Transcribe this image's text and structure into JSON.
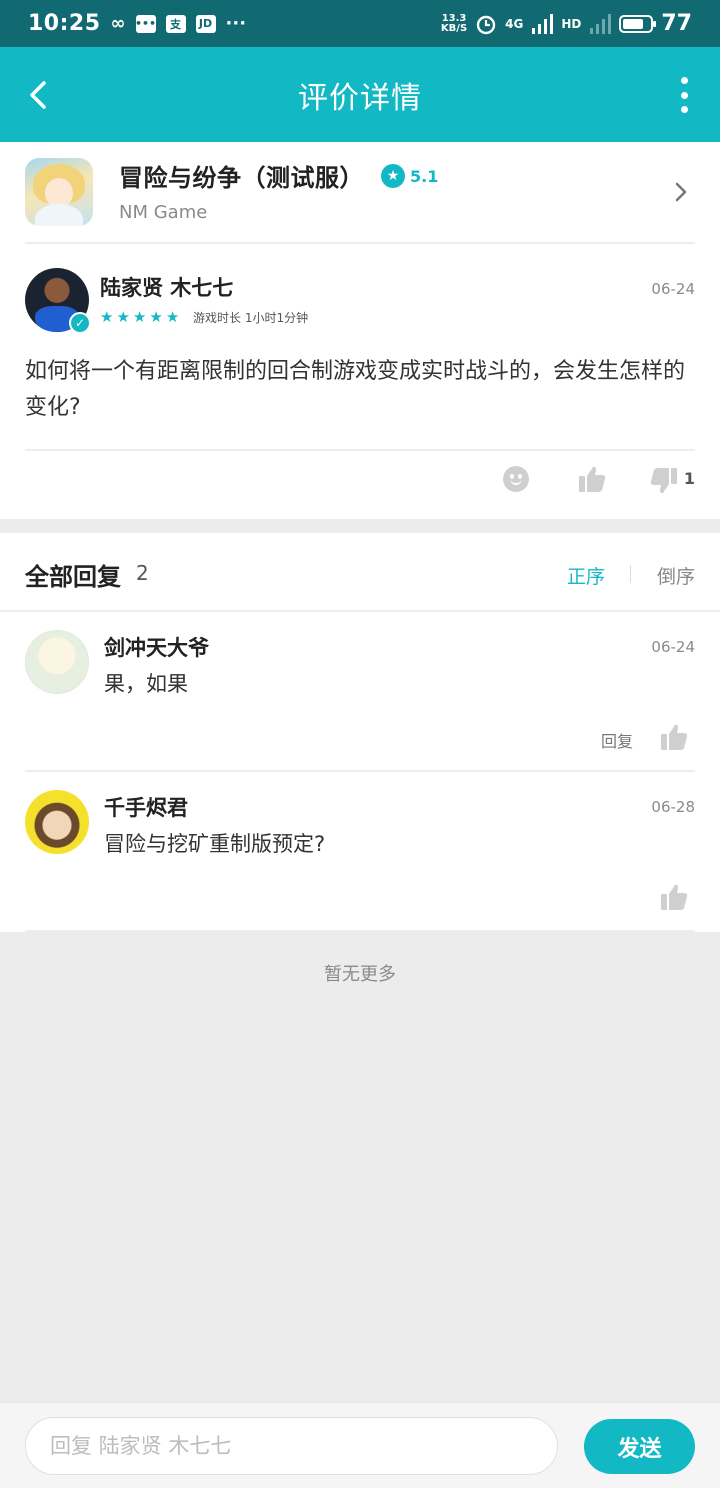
{
  "status_bar": {
    "time": "10:25",
    "infinity_glyph": "∞",
    "app_badge_pay": "支",
    "app_badge_jd": "JD",
    "more_glyph": "···",
    "net_speed_top": "13.3",
    "net_speed_bottom": "KB/S",
    "signal_label": "4G",
    "hd_label": "HD",
    "battery_level": "77"
  },
  "app_bar": {
    "title": "评价详情",
    "back_icon": "chevron-left-icon",
    "more_icon": "more-vertical-icon"
  },
  "game": {
    "title": "冒险与纷争（测试服）",
    "rating": "5.1",
    "developer": "NM Game"
  },
  "review": {
    "author": "陆家贤 木七七",
    "date": "06-24",
    "stars": 5,
    "playtime": "游戏时长 1小时1分钟",
    "text": "如何将一个有距离限制的回合制游戏变成实时战斗的，会发生怎样的变化?",
    "dislike_count": "1"
  },
  "replies": {
    "title": "全部回复",
    "count": "2",
    "sort_asc": "正序",
    "sort_desc": "倒序",
    "items": [
      {
        "name": "剑冲天大爷",
        "date": "06-24",
        "text": "果，如果",
        "reply_label": "回复"
      },
      {
        "name": "千手烬君",
        "date": "06-28",
        "text": "冒险与挖矿重制版预定?"
      }
    ],
    "no_more": "暂无更多"
  },
  "bottom_bar": {
    "input_placeholder": "回复 陆家贤 木七七",
    "send_label": "发送"
  },
  "colors": {
    "accent": "#13b8c5",
    "status_bar": "#116a72"
  }
}
